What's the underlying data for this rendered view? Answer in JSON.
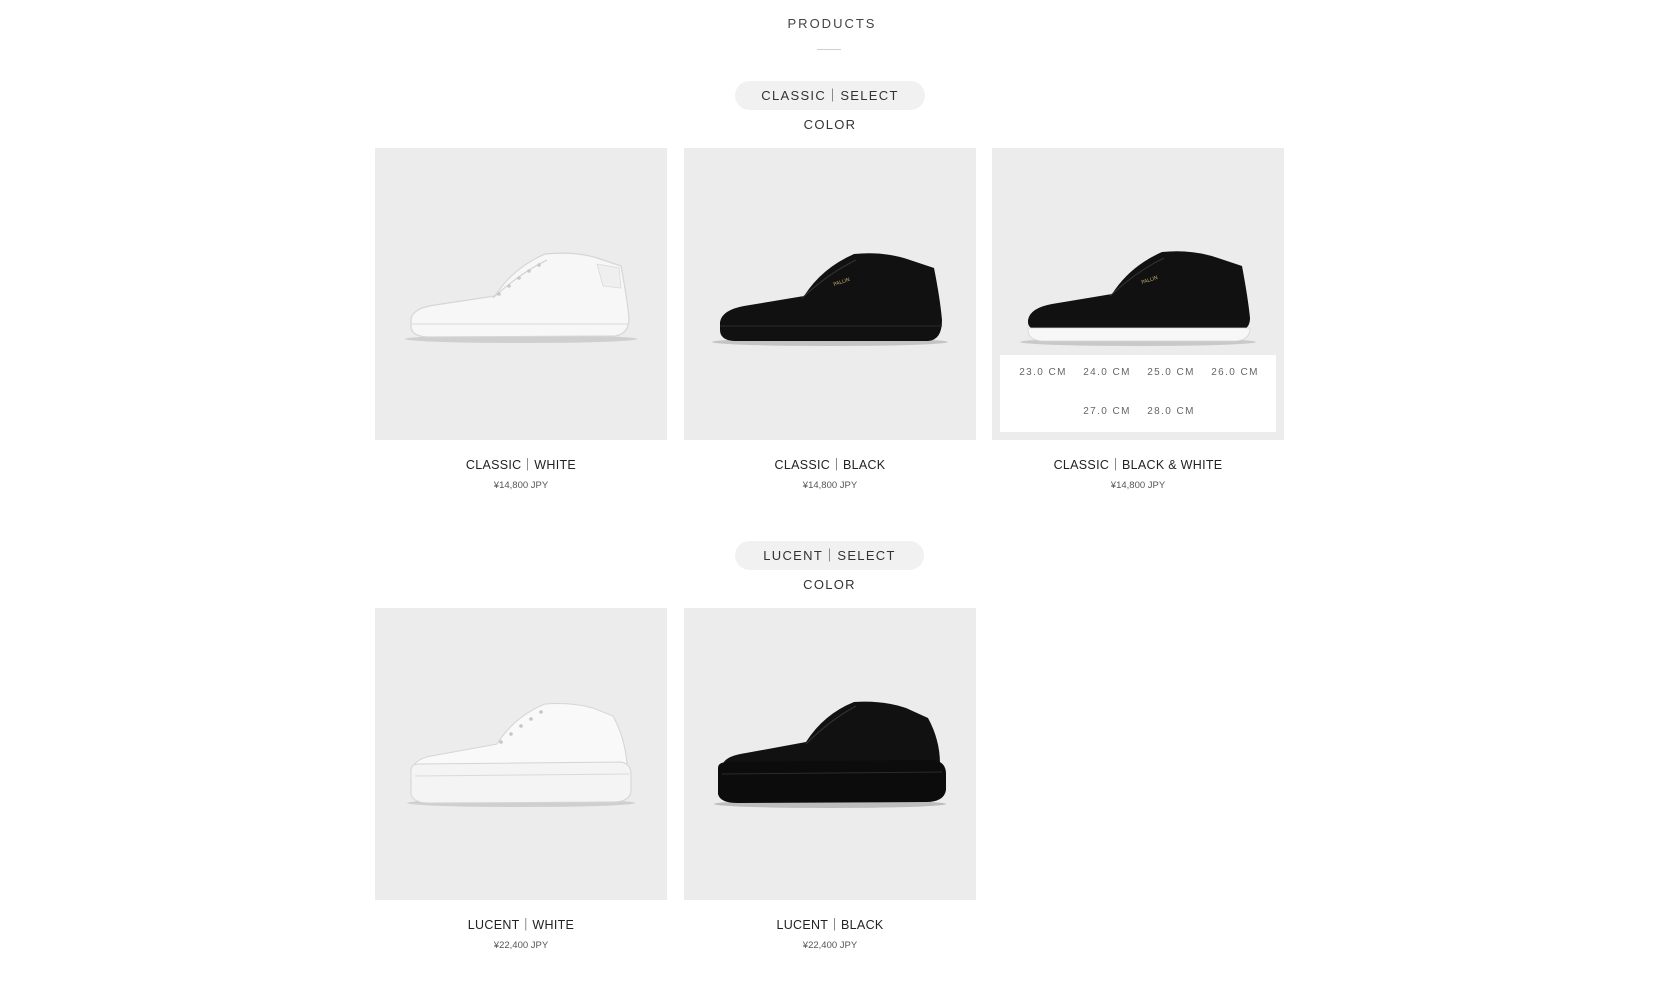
{
  "section": {
    "title": "PRODUCTS"
  },
  "collections": [
    {
      "pill": "CLASSIC｜SELECT COLOR",
      "products": [
        {
          "name": "CLASSIC｜WHITE",
          "price": "¥14,800 JPY"
        },
        {
          "name": "CLASSIC｜BLACK",
          "price": "¥14,800 JPY"
        },
        {
          "name": "CLASSIC｜BLACK & WHITE",
          "price": "¥14,800 JPY",
          "sizes": [
            "23.0 CM",
            "24.0 CM",
            "25.0 CM",
            "26.0 CM",
            "27.0 CM",
            "28.0 CM"
          ]
        }
      ]
    },
    {
      "pill": "LUCENT｜SELECT COLOR",
      "products": [
        {
          "name": "LUCENT｜WHITE",
          "price": "¥22,400 JPY"
        },
        {
          "name": "LUCENT｜BLACK",
          "price": "¥22,400 JPY"
        }
      ]
    }
  ],
  "colors": {
    "image_bg": "#ececec",
    "pill_bg": "#f1f1f1",
    "shoe_white": "#f7f7f7",
    "shoe_black": "#111111"
  }
}
